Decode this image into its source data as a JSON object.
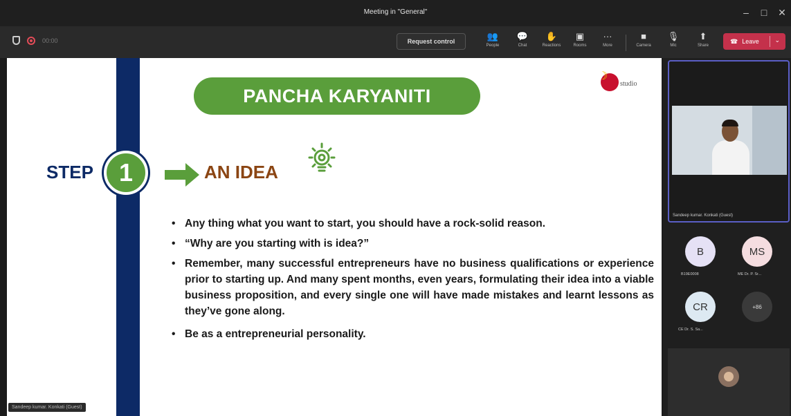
{
  "window": {
    "title": "Meeting in \"General\"",
    "minimize": "–",
    "maximize": "□",
    "close": "✕"
  },
  "toolbar": {
    "timer": "00:00",
    "request_control": "Request control",
    "buttons": [
      {
        "icon": "people-icon",
        "glyph": "👥",
        "label": "People"
      },
      {
        "icon": "chat-icon",
        "glyph": "💬",
        "label": "Chat"
      },
      {
        "icon": "reactions-icon",
        "glyph": "✋",
        "label": "Reactions"
      },
      {
        "icon": "rooms-icon",
        "glyph": "▣",
        "label": "Rooms"
      },
      {
        "icon": "more-icon",
        "glyph": "···",
        "label": "More"
      },
      {
        "icon": "camera-icon",
        "glyph": "■",
        "label": "Camera"
      },
      {
        "icon": "mic-icon",
        "glyph": "🎙",
        "label": "Mic"
      },
      {
        "icon": "share-icon",
        "glyph": "⬆",
        "label": "Share"
      }
    ],
    "leave_label": "Leave",
    "leave_color": "#c4314b"
  },
  "slide": {
    "title": "PANCHA KARYANITI",
    "logo_text": "studio",
    "step_label": "STEP",
    "step_number": "1",
    "idea_label": "AN IDEA",
    "bullets": [
      "Any thing what you want to start, you should have a rock-solid reason.",
      "“Why are you starting with is idea?”",
      "Remember, many successful entrepreneurs have no business qualifications or experience prior to starting up. And many spent months, even years, formulating their idea into a viable business proposition, and every single one will have made mistakes and learnt lessons as they’ve gone along.",
      " Be as a entrepreneurial personality."
    ],
    "presenter_tag": "Sandeep kumar. Konkati (Guest)",
    "colors": {
      "green": "#5a9e3b",
      "navy": "#0d2a66",
      "brown": "#8b4513"
    }
  },
  "participants": {
    "active_video_name": "Sandeep kumar. Konkati (Guest)",
    "tiles": [
      {
        "initials": "B",
        "label": "B19E0008",
        "color": "#e5e1f5"
      },
      {
        "initials": "MS",
        "label": "ME Dr. P. Sr...",
        "color": "#f5dde0"
      },
      {
        "initials": "CR",
        "label": "CE Dr. S. Sa...",
        "color": "#dde9f2"
      }
    ],
    "more_count": "+86"
  }
}
